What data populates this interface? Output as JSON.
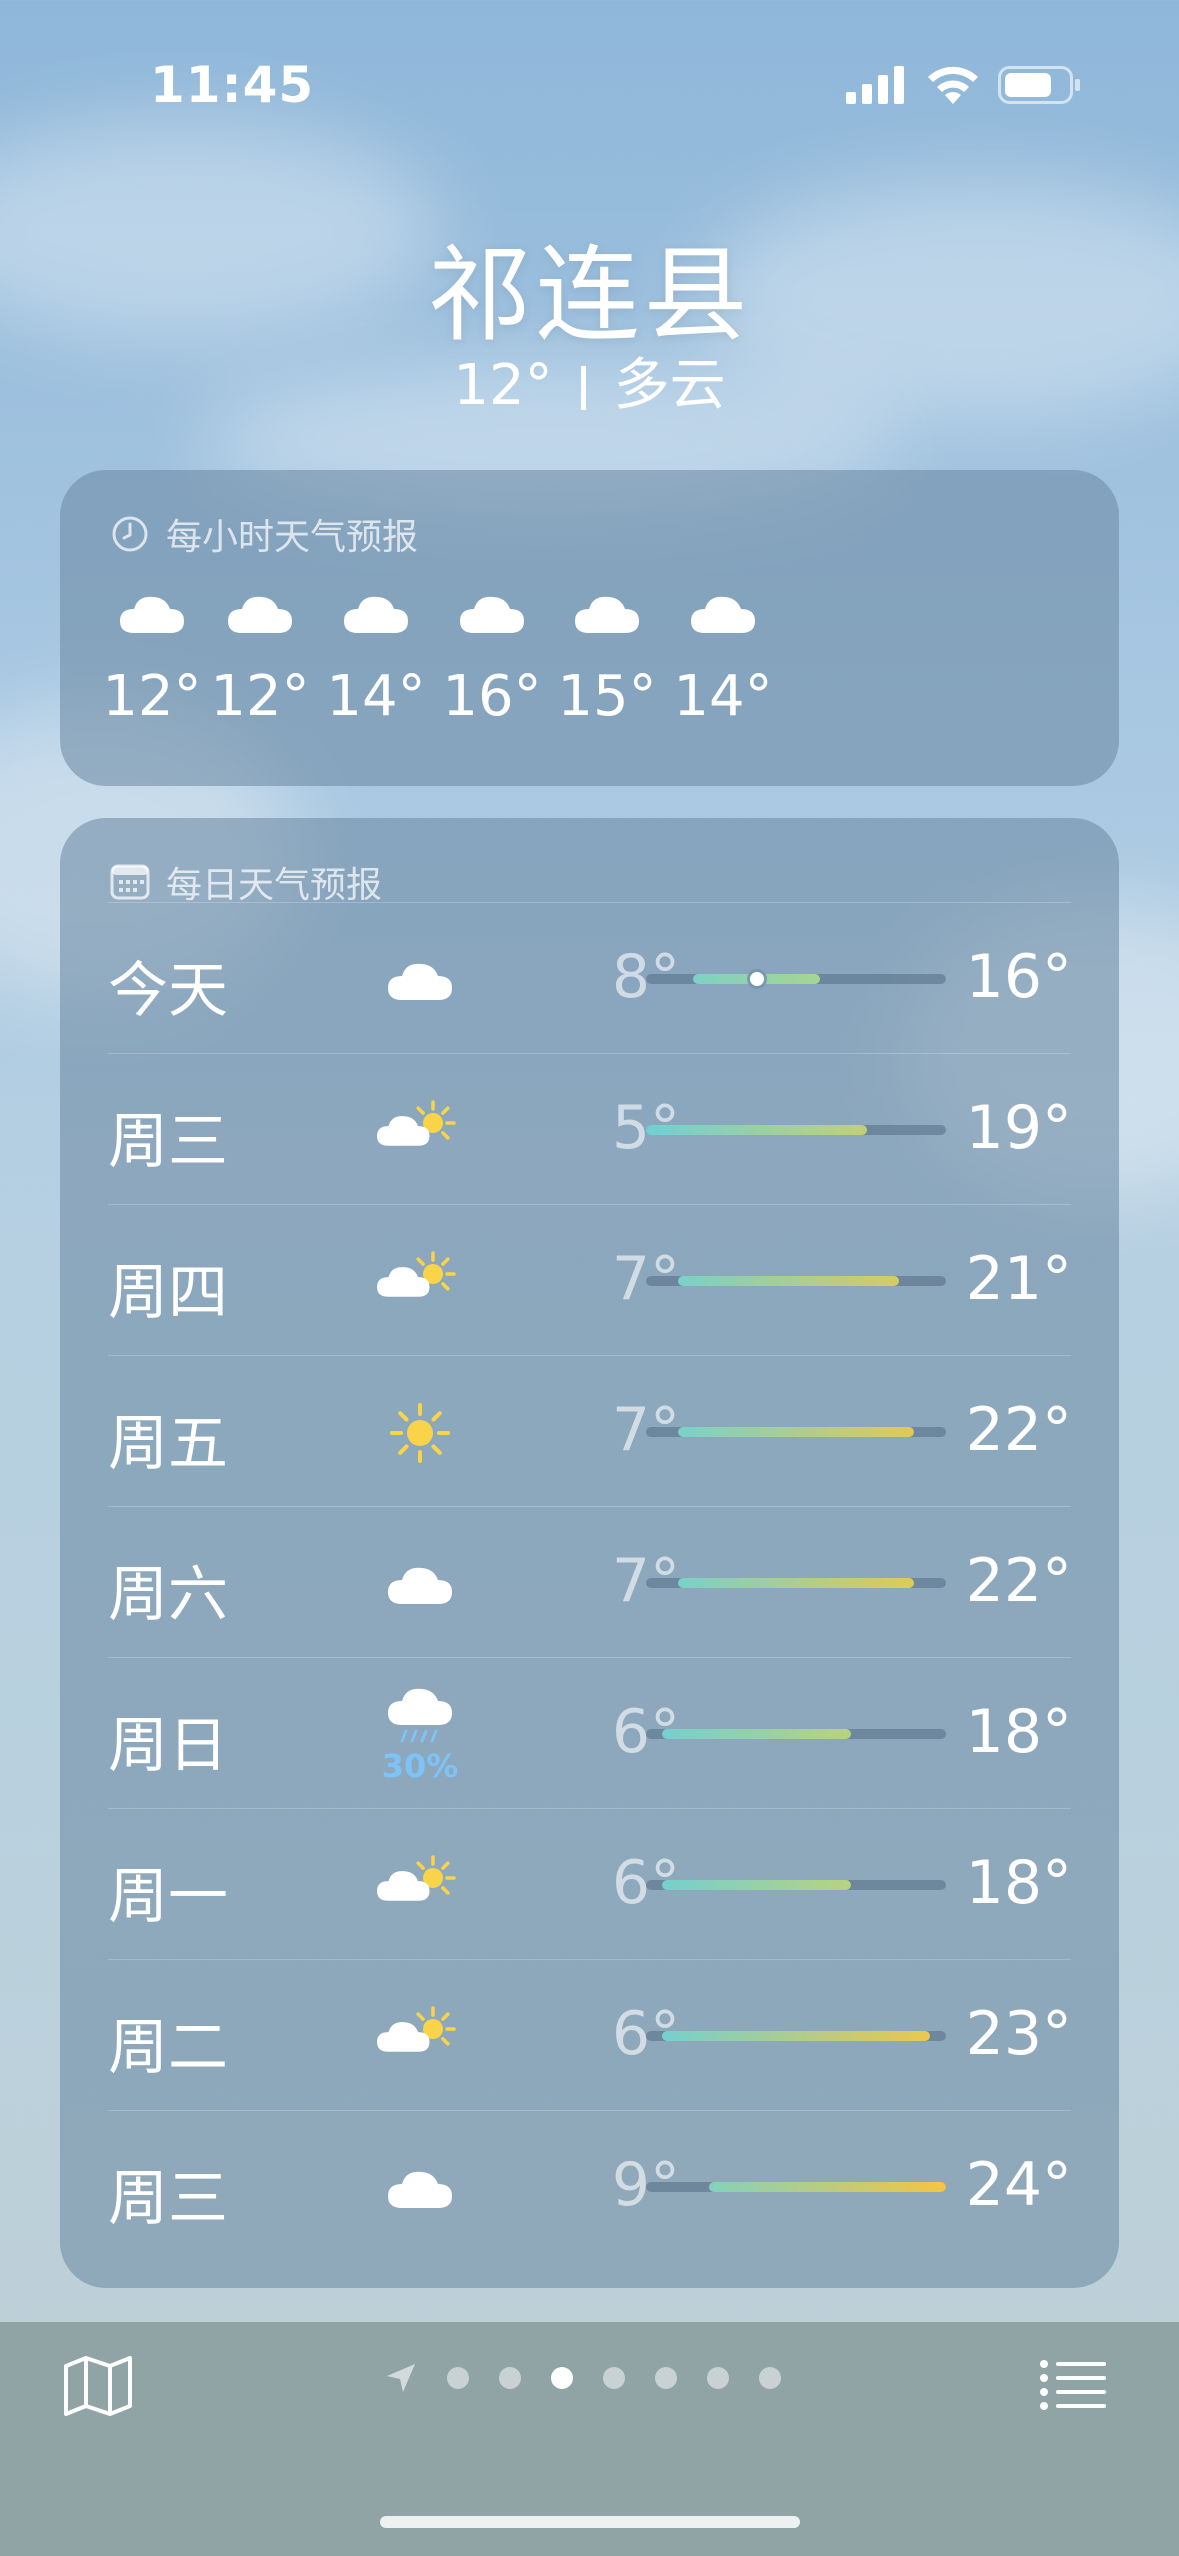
{
  "status_bar": {
    "time": "11:45"
  },
  "location": {
    "city": "祁连县",
    "temperature": "12°",
    "condition": "多云"
  },
  "hourly": {
    "title": "每小时天气预报",
    "items": [
      {
        "icon": "cloud-icon",
        "temp": "12°"
      },
      {
        "icon": "cloud-icon",
        "temp": "12°"
      },
      {
        "icon": "cloud-icon",
        "temp": "14°"
      },
      {
        "icon": "cloud-icon",
        "temp": "16°"
      },
      {
        "icon": "cloud-icon",
        "temp": "15°"
      },
      {
        "icon": "cloud-icon",
        "temp": "14°"
      }
    ]
  },
  "daily": {
    "title": "每日天气预报",
    "range_min": 5,
    "range_max": 24,
    "current_temp": 12,
    "items": [
      {
        "day": "今天",
        "icon": "cloud-icon",
        "low": "8°",
        "high": "16°",
        "low_val": 8,
        "high_val": 16,
        "precip": ""
      },
      {
        "day": "周三",
        "icon": "partly-sunny-icon",
        "low": "5°",
        "high": "19°",
        "low_val": 5,
        "high_val": 19,
        "precip": ""
      },
      {
        "day": "周四",
        "icon": "partly-sunny-icon",
        "low": "7°",
        "high": "21°",
        "low_val": 7,
        "high_val": 21,
        "precip": ""
      },
      {
        "day": "周五",
        "icon": "sun-icon",
        "low": "7°",
        "high": "22°",
        "low_val": 7,
        "high_val": 22,
        "precip": ""
      },
      {
        "day": "周六",
        "icon": "cloud-icon",
        "low": "7°",
        "high": "22°",
        "low_val": 7,
        "high_val": 22,
        "precip": ""
      },
      {
        "day": "周日",
        "icon": "rain-icon",
        "low": "6°",
        "high": "18°",
        "low_val": 6,
        "high_val": 18,
        "precip": "30%"
      },
      {
        "day": "周一",
        "icon": "partly-sunny-icon",
        "low": "6°",
        "high": "18°",
        "low_val": 6,
        "high_val": 18,
        "precip": ""
      },
      {
        "day": "周二",
        "icon": "partly-sunny-icon",
        "low": "6°",
        "high": "23°",
        "low_val": 6,
        "high_val": 23,
        "precip": ""
      },
      {
        "day": "周三",
        "icon": "cloud-icon",
        "low": "9°",
        "high": "24°",
        "low_val": 9,
        "high_val": 24,
        "precip": ""
      }
    ]
  },
  "toolbar": {
    "page_count": 7,
    "active_page": 3
  },
  "colors": {
    "cool": "#6fd0d6",
    "mid": "#a8d590",
    "warm": "#f5c542",
    "sun": "#f9d448",
    "rain": "#7ec3f5"
  }
}
